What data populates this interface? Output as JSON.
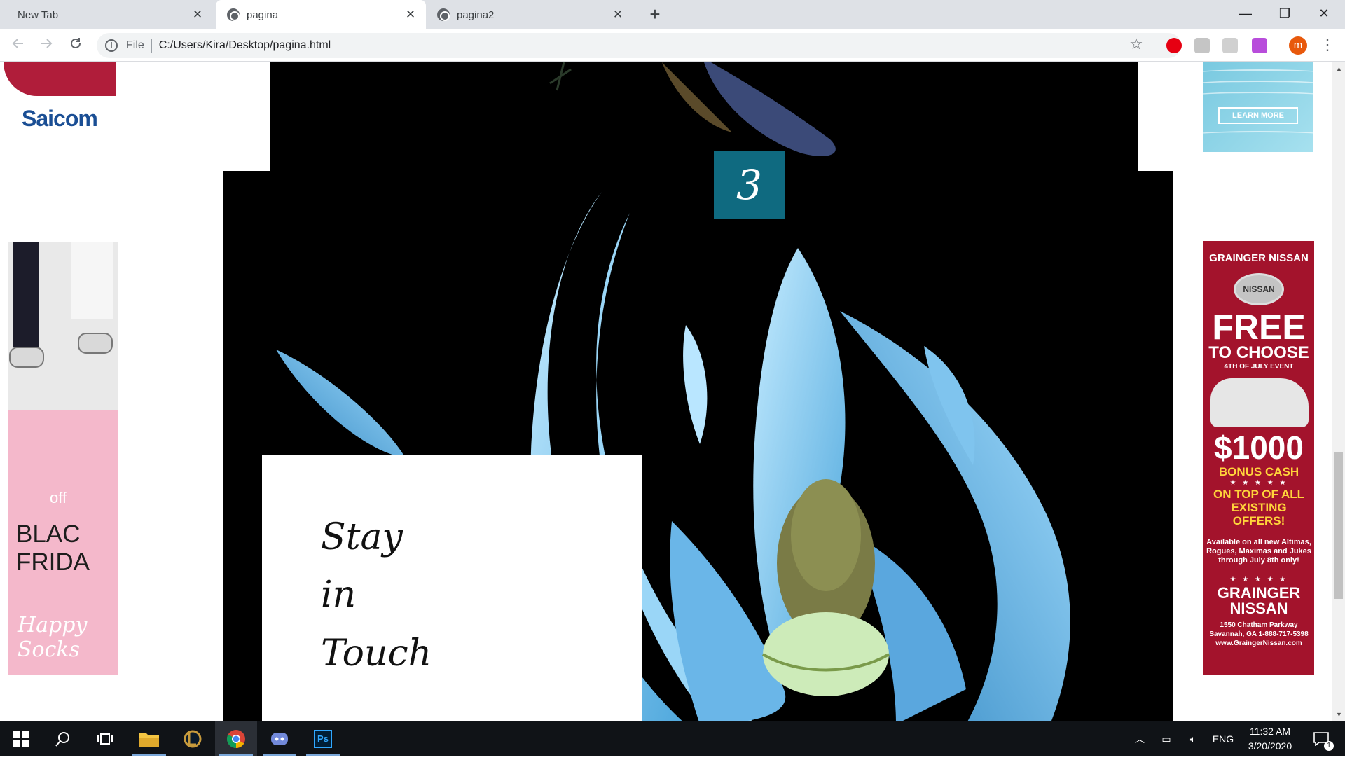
{
  "browser": {
    "tabs": [
      {
        "title": "New Tab",
        "active": false,
        "has_favicon": false
      },
      {
        "title": "pagina",
        "active": true,
        "has_favicon": true
      },
      {
        "title": "pagina2",
        "active": false,
        "has_favicon": true
      }
    ],
    "close_glyph": "✕",
    "new_tab_glyph": "+",
    "window_controls": {
      "minimize": "—",
      "restore": "❐",
      "close": "✕"
    },
    "address": {
      "scheme_label": "File",
      "url": "C:/Users/Kira/Desktop/pagina.html"
    },
    "profile_initial": "m"
  },
  "page": {
    "slide_number": "3",
    "stay_card": {
      "line1": "Stay",
      "line2": "in",
      "line3": "Touch"
    },
    "ads": {
      "saicom": {
        "logo": "Saicom"
      },
      "learn_more": {
        "cta": "LEARN MORE"
      },
      "happy_socks": {
        "off": "off",
        "line1": "BLAC",
        "line2": "FRIDA",
        "brand": "Happy Socks"
      },
      "nissan": {
        "header": "GRAINGER NISSAN",
        "logo": "NISSAN",
        "free": "FREE",
        "to_choose": "TO CHOOSE",
        "event": "4TH OF JULY EVENT",
        "cash": "$1000",
        "bonus": "BONUS CASH",
        "on_top": "ON TOP OF ALL EXISTING OFFERS!",
        "fine_print": "Available on all new Altimas, Rogues, Maximas and Jukes through July 8th only!",
        "dealer": "GRAINGER NISSAN",
        "address": "1550 Chatham Parkway Savannah, GA 1-888-717-5398 www.GraingerNissan.com",
        "stars": "★ ★ ★ ★ ★"
      }
    }
  },
  "taskbar": {
    "apps": [
      "start-icon",
      "search-icon",
      "task-view-icon",
      "file-explorer-icon",
      "league-of-legends-icon",
      "chrome-icon",
      "discord-icon",
      "photoshop-icon"
    ],
    "photoshop_label": "Ps",
    "language": "ENG",
    "time": "11:32 AM",
    "date": "3/20/2020",
    "notification_count": "1"
  },
  "colors": {
    "tabstrip": "#dee1e6",
    "badge": "#0f6a80",
    "flower": "#8fd3f3",
    "taskbar": "#101317",
    "nissan_red": "#a3132c",
    "socks_pink": "#f4b8cb"
  }
}
